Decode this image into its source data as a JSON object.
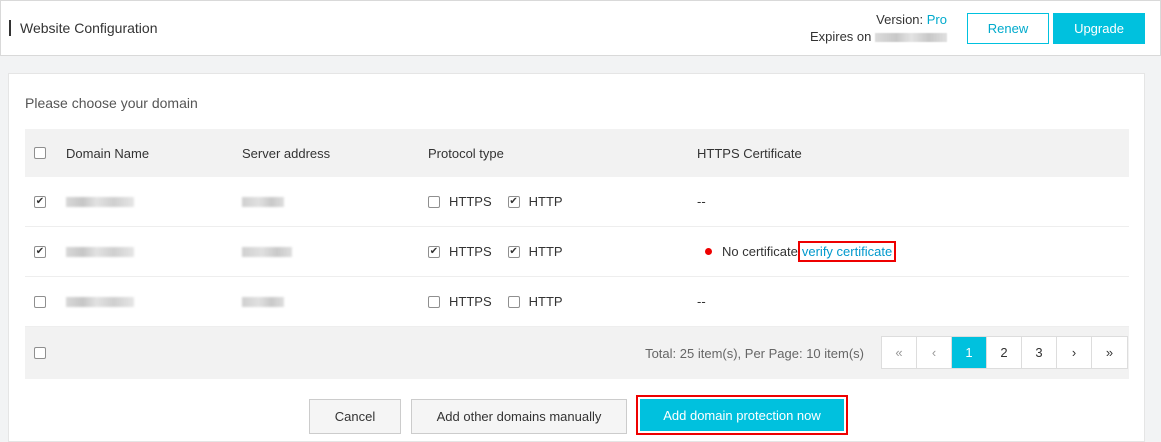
{
  "header": {
    "title": "Website Configuration",
    "version_label": "Version: ",
    "version_value": "Pro",
    "expires_label": "Expires on",
    "renew_label": "Renew",
    "upgrade_label": "Upgrade"
  },
  "card": {
    "title": "Please choose your domain"
  },
  "table": {
    "columns": [
      "Domain Name",
      "Server address",
      "Protocol type",
      "HTTPS Certificate"
    ],
    "rows": [
      {
        "checked": true,
        "https": false,
        "http": true,
        "https_label": "HTTPS",
        "http_label": "HTTP",
        "cert": "--"
      },
      {
        "checked": true,
        "https": true,
        "http": true,
        "https_label": "HTTPS",
        "http_label": "HTTP",
        "cert_status": "No certificate",
        "cert_link": "verify certificate"
      },
      {
        "checked": false,
        "https": false,
        "http": false,
        "https_label": "HTTPS",
        "http_label": "HTTP",
        "cert": "--"
      }
    ],
    "total_text": "Total: 25 item(s), Per Page: 10 item(s)"
  },
  "pager": {
    "first": "«",
    "prev": "‹",
    "pages": [
      "1",
      "2",
      "3"
    ],
    "active_page": "1",
    "next": "›",
    "last": "»"
  },
  "actions": {
    "cancel_label": "Cancel",
    "add_manual_label": "Add other domains manually",
    "add_protection_label": "Add domain protection now"
  },
  "colors": {
    "accent": "#00c1de",
    "link": "#0099cc",
    "highlight": "#ee0000"
  }
}
